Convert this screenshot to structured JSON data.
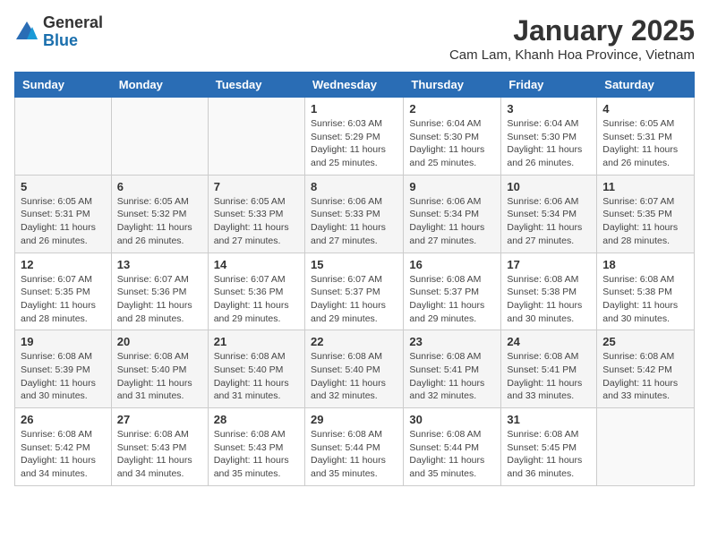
{
  "logo": {
    "general": "General",
    "blue": "Blue"
  },
  "header": {
    "month": "January 2025",
    "location": "Cam Lam, Khanh Hoa Province, Vietnam"
  },
  "weekdays": [
    "Sunday",
    "Monday",
    "Tuesday",
    "Wednesday",
    "Thursday",
    "Friday",
    "Saturday"
  ],
  "weeks": [
    [
      {
        "day": "",
        "info": ""
      },
      {
        "day": "",
        "info": ""
      },
      {
        "day": "",
        "info": ""
      },
      {
        "day": "1",
        "info": "Sunrise: 6:03 AM\nSunset: 5:29 PM\nDaylight: 11 hours\nand 25 minutes."
      },
      {
        "day": "2",
        "info": "Sunrise: 6:04 AM\nSunset: 5:30 PM\nDaylight: 11 hours\nand 25 minutes."
      },
      {
        "day": "3",
        "info": "Sunrise: 6:04 AM\nSunset: 5:30 PM\nDaylight: 11 hours\nand 26 minutes."
      },
      {
        "day": "4",
        "info": "Sunrise: 6:05 AM\nSunset: 5:31 PM\nDaylight: 11 hours\nand 26 minutes."
      }
    ],
    [
      {
        "day": "5",
        "info": "Sunrise: 6:05 AM\nSunset: 5:31 PM\nDaylight: 11 hours\nand 26 minutes."
      },
      {
        "day": "6",
        "info": "Sunrise: 6:05 AM\nSunset: 5:32 PM\nDaylight: 11 hours\nand 26 minutes."
      },
      {
        "day": "7",
        "info": "Sunrise: 6:05 AM\nSunset: 5:33 PM\nDaylight: 11 hours\nand 27 minutes."
      },
      {
        "day": "8",
        "info": "Sunrise: 6:06 AM\nSunset: 5:33 PM\nDaylight: 11 hours\nand 27 minutes."
      },
      {
        "day": "9",
        "info": "Sunrise: 6:06 AM\nSunset: 5:34 PM\nDaylight: 11 hours\nand 27 minutes."
      },
      {
        "day": "10",
        "info": "Sunrise: 6:06 AM\nSunset: 5:34 PM\nDaylight: 11 hours\nand 27 minutes."
      },
      {
        "day": "11",
        "info": "Sunrise: 6:07 AM\nSunset: 5:35 PM\nDaylight: 11 hours\nand 28 minutes."
      }
    ],
    [
      {
        "day": "12",
        "info": "Sunrise: 6:07 AM\nSunset: 5:35 PM\nDaylight: 11 hours\nand 28 minutes."
      },
      {
        "day": "13",
        "info": "Sunrise: 6:07 AM\nSunset: 5:36 PM\nDaylight: 11 hours\nand 28 minutes."
      },
      {
        "day": "14",
        "info": "Sunrise: 6:07 AM\nSunset: 5:36 PM\nDaylight: 11 hours\nand 29 minutes."
      },
      {
        "day": "15",
        "info": "Sunrise: 6:07 AM\nSunset: 5:37 PM\nDaylight: 11 hours\nand 29 minutes."
      },
      {
        "day": "16",
        "info": "Sunrise: 6:08 AM\nSunset: 5:37 PM\nDaylight: 11 hours\nand 29 minutes."
      },
      {
        "day": "17",
        "info": "Sunrise: 6:08 AM\nSunset: 5:38 PM\nDaylight: 11 hours\nand 30 minutes."
      },
      {
        "day": "18",
        "info": "Sunrise: 6:08 AM\nSunset: 5:38 PM\nDaylight: 11 hours\nand 30 minutes."
      }
    ],
    [
      {
        "day": "19",
        "info": "Sunrise: 6:08 AM\nSunset: 5:39 PM\nDaylight: 11 hours\nand 30 minutes."
      },
      {
        "day": "20",
        "info": "Sunrise: 6:08 AM\nSunset: 5:40 PM\nDaylight: 11 hours\nand 31 minutes."
      },
      {
        "day": "21",
        "info": "Sunrise: 6:08 AM\nSunset: 5:40 PM\nDaylight: 11 hours\nand 31 minutes."
      },
      {
        "day": "22",
        "info": "Sunrise: 6:08 AM\nSunset: 5:40 PM\nDaylight: 11 hours\nand 32 minutes."
      },
      {
        "day": "23",
        "info": "Sunrise: 6:08 AM\nSunset: 5:41 PM\nDaylight: 11 hours\nand 32 minutes."
      },
      {
        "day": "24",
        "info": "Sunrise: 6:08 AM\nSunset: 5:41 PM\nDaylight: 11 hours\nand 33 minutes."
      },
      {
        "day": "25",
        "info": "Sunrise: 6:08 AM\nSunset: 5:42 PM\nDaylight: 11 hours\nand 33 minutes."
      }
    ],
    [
      {
        "day": "26",
        "info": "Sunrise: 6:08 AM\nSunset: 5:42 PM\nDaylight: 11 hours\nand 34 minutes."
      },
      {
        "day": "27",
        "info": "Sunrise: 6:08 AM\nSunset: 5:43 PM\nDaylight: 11 hours\nand 34 minutes."
      },
      {
        "day": "28",
        "info": "Sunrise: 6:08 AM\nSunset: 5:43 PM\nDaylight: 11 hours\nand 35 minutes."
      },
      {
        "day": "29",
        "info": "Sunrise: 6:08 AM\nSunset: 5:44 PM\nDaylight: 11 hours\nand 35 minutes."
      },
      {
        "day": "30",
        "info": "Sunrise: 6:08 AM\nSunset: 5:44 PM\nDaylight: 11 hours\nand 35 minutes."
      },
      {
        "day": "31",
        "info": "Sunrise: 6:08 AM\nSunset: 5:45 PM\nDaylight: 11 hours\nand 36 minutes."
      },
      {
        "day": "",
        "info": ""
      }
    ]
  ]
}
